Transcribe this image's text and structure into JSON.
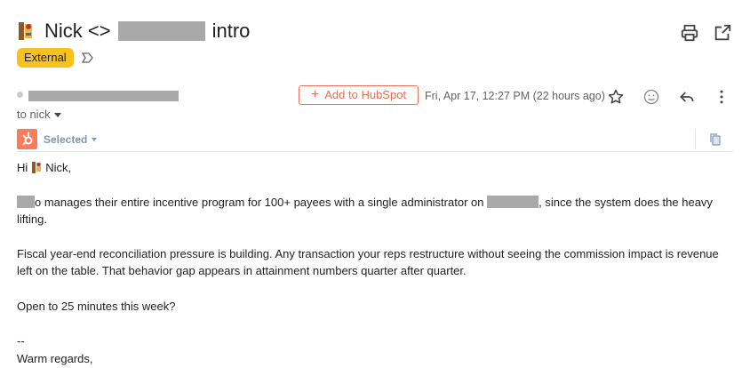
{
  "subject": {
    "before": "Nick <>",
    "after": "intro"
  },
  "label": "External",
  "sender": {
    "to_line": "to nick"
  },
  "hubspot": {
    "add_button": "Add to HubSpot",
    "selected_label": "Selected"
  },
  "meta": {
    "date": "Fri, Apr 17, 12:27 PM (22 hours ago)"
  },
  "body": {
    "greeting_prefix": "Hi",
    "greeting_name": "Nick,",
    "p1_mid": "o manages their entire incentive program for 100+ payees with a single administrator on",
    "p1_tail": ", since the system does the heavy lifting.",
    "p2": "Fiscal year-end reconciliation pressure is building. Any transaction your reps restructure without seeing the commission impact is revenue left on the table. That behavior gap appears in attainment numbers quarter after quarter.",
    "p3": "Open to 25 minutes this week?",
    "sig_dash": "--",
    "sig_closing": "Warm regards,"
  },
  "colors": {
    "label_bg": "#f8c21c",
    "hubspot_orange": "#ec6f58",
    "hubspot_selected": "#7c98b6",
    "redaction": "#a9a9a9"
  },
  "icons": {
    "print": "print-icon",
    "open_new": "open-in-new-window-icon",
    "label_arrow": "label-important-arrow-icon",
    "star": "star-icon",
    "emoji": "emoji-reaction-icon",
    "reply": "reply-icon",
    "more": "more-vertical-icon",
    "hubspot_logo": "hubspot-logo-icon",
    "copy": "copy-icon"
  }
}
